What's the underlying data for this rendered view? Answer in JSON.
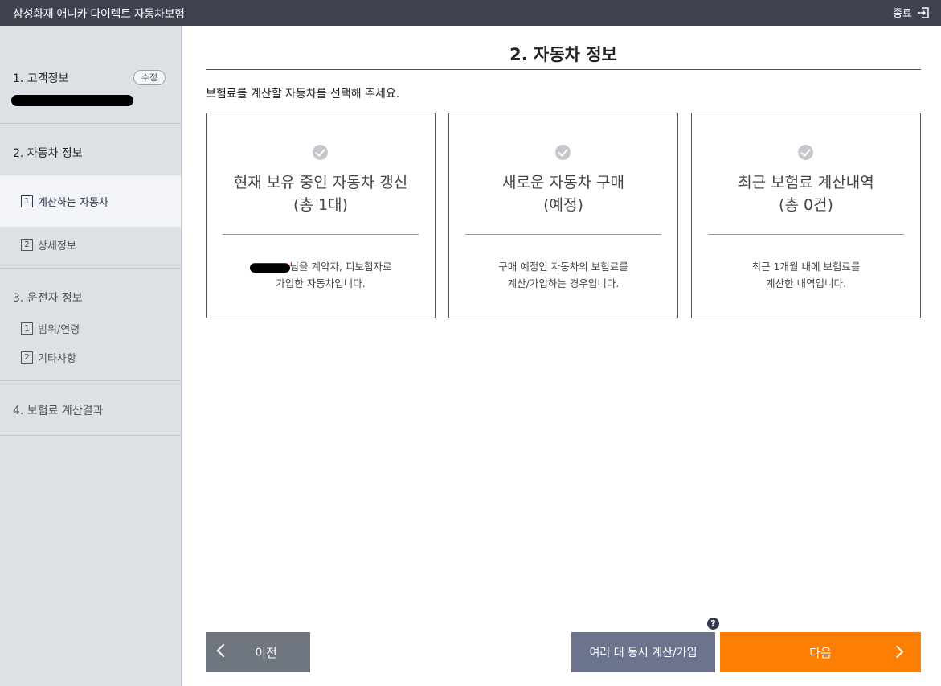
{
  "window": {
    "title": "삼성화재 애니카 다이렉트 자동차보험",
    "close_label": "종료"
  },
  "sidebar": {
    "customer": {
      "title": "1. 고객정보",
      "edit_label": "수정"
    },
    "car": {
      "title": "2. 자동차 정보",
      "items": [
        {
          "num": "1",
          "label": "계산하는 자동차",
          "active": true
        },
        {
          "num": "2",
          "label": "상세정보"
        }
      ]
    },
    "driver": {
      "title": "3. 운전자 정보",
      "items": [
        {
          "num": "1",
          "label": "범위/연령"
        },
        {
          "num": "2",
          "label": "기타사항"
        }
      ]
    },
    "result": {
      "title": "4. 보험료 계산결과"
    }
  },
  "main": {
    "title": "2. 자동차 정보",
    "instruction": "보험료를 계산할 자동차를 선택해 주세요.",
    "cards": [
      {
        "title_line1": "현재 보유 중인 자동차 갱신",
        "title_line2": "(총 1대)",
        "desc_line1": "님을 계약자, 피보험자로",
        "desc_line2": "가입한 자동차입니다."
      },
      {
        "title_line1": "새로운 자동차 구매",
        "title_line2": "(예정)",
        "desc_line1": "구매 예정인 자동차의 보험료를",
        "desc_line2": "계산/가입하는 경우입니다."
      },
      {
        "title_line1": "최근 보험료 계산내역",
        "title_line2": "(총 0건)",
        "desc_line1": "최근 1개월 내에 보험료를",
        "desc_line2": "계산한 내역입니다."
      }
    ]
  },
  "footer": {
    "prev_label": "이전",
    "multi_label": "여러 대 동시 계산/가입",
    "next_label": "다음",
    "help_label": "?"
  },
  "colors": {
    "titlebar": "#3f4350",
    "next_button": "#fc7f03",
    "multi_button": "#6b748c",
    "prev_button": "#70767f"
  }
}
